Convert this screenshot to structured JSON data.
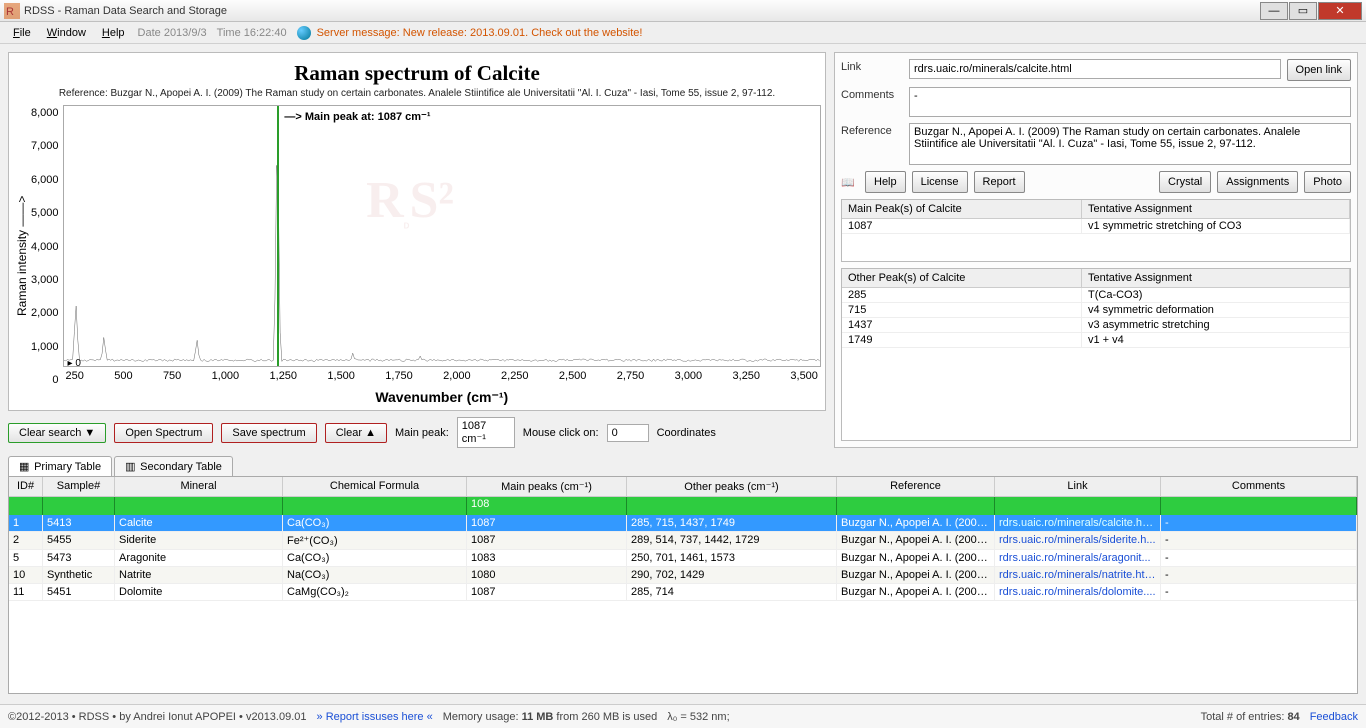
{
  "window": {
    "title": "RDSS - Raman Data Search and Storage"
  },
  "menu": {
    "items": [
      "File",
      "Window",
      "Help"
    ],
    "date_label": "Date 2013/9/3",
    "time_label": "Time 16:22:40",
    "server_msg": "Server message: New release: 2013.09.01. Check out the website!"
  },
  "chart_data": {
    "type": "line",
    "title": "Raman spectrum of Calcite",
    "reference": "Reference: Buzgar N., Apopei A. I. (2009) The Raman study on certain carbonates. Analele Stiintifice ale Universitatii \"Al. I. Cuza\" - Iasi, Tome 55, issue 2, 97-112.",
    "xlabel": "Wavenumber (cm⁻¹)",
    "ylabel": "Raman intensity ——>",
    "xlim": [
      100,
      3600
    ],
    "ylim": [
      0,
      8500
    ],
    "x_ticks": [
      250,
      500,
      750,
      1000,
      1250,
      1500,
      1750,
      2000,
      2250,
      2500,
      2750,
      3000,
      3250,
      3500
    ],
    "y_ticks": [
      0,
      1000,
      2000,
      3000,
      4000,
      5000,
      6000,
      7000,
      8000
    ],
    "main_peak_annotation": "—> Main peak at: 1087 cm⁻¹",
    "peaks": [
      {
        "x": 155,
        "y": 2100
      },
      {
        "x": 285,
        "y": 1000
      },
      {
        "x": 715,
        "y": 900
      },
      {
        "x": 1087,
        "y": 8200
      },
      {
        "x": 1437,
        "y": 450
      },
      {
        "x": 1749,
        "y": 350
      }
    ],
    "baseline": 150
  },
  "toolbar": {
    "clear_search": "Clear search ▼",
    "open_spectrum": "Open Spectrum",
    "save_spectrum": "Save spectrum",
    "clear": "Clear ▲",
    "main_peak_label": "Main peak:",
    "main_peak_value": "1087 cm⁻¹",
    "mouse_click_label": "Mouse click on:",
    "mouse_click_value": "0",
    "coordinates_label": "Coordinates"
  },
  "info": {
    "link_label": "Link",
    "link_value": "rdrs.uaic.ro/minerals/calcite.html",
    "open_link": "Open link",
    "comments_label": "Comments",
    "comments_value": "-",
    "reference_label": "Reference",
    "reference_value": "Buzgar N., Apopei A. I. (2009) The Raman study on certain carbonates. Analele Stiintifice ale Universitatii \"Al. I. Cuza\" - Iasi, Tome 55, issue 2, 97-112.",
    "buttons": {
      "help": "Help",
      "license": "License",
      "report": "Report",
      "crystal": "Crystal",
      "assignments": "Assignments",
      "photo": "Photo"
    },
    "main_peaks": {
      "col1": "Main Peak(s) of Calcite",
      "col2": "Tentative Assignment",
      "rows": [
        {
          "peak": "1087",
          "assign": "v1 symmetric stretching of CO3"
        }
      ]
    },
    "other_peaks": {
      "col1": "Other Peak(s) of Calcite",
      "col2": "Tentative Assignment",
      "rows": [
        {
          "peak": "285",
          "assign": "T(Ca-CO3)"
        },
        {
          "peak": "715",
          "assign": "v4 symmetric deformation"
        },
        {
          "peak": "1437",
          "assign": "v3 asymmetric stretching"
        },
        {
          "peak": "1749",
          "assign": "v1 + v4"
        }
      ]
    }
  },
  "tabs": {
    "primary": "Primary Table",
    "secondary": "Secondary Table"
  },
  "grid": {
    "headers": [
      "ID#",
      "Sample#",
      "Mineral",
      "Chemical Formula",
      "Main peaks (cm⁻¹)",
      "Other peaks (cm⁻¹)",
      "Reference",
      "Link",
      "Comments"
    ],
    "filter_main": "108",
    "rows": [
      {
        "id": "1",
        "sample": "5413",
        "mineral": "Calcite",
        "formula": "Ca(CO₃)",
        "main": "1087",
        "other": "285, 715, 1437, 1749",
        "ref": "Buzgar N., Apopei A. I. (2009...",
        "link": "rdrs.uaic.ro/minerals/calcite.html",
        "com": "-",
        "selected": true
      },
      {
        "id": "2",
        "sample": "5455",
        "mineral": "Siderite",
        "formula": "Fe²⁺(CO₃)",
        "main": "1087",
        "other": "289, 514, 737, 1442, 1729",
        "ref": "Buzgar N., Apopei A. I. (2009...",
        "link": "rdrs.uaic.ro/minerals/siderite.h...",
        "com": "-"
      },
      {
        "id": "5",
        "sample": "5473",
        "mineral": "Aragonite",
        "formula": "Ca(CO₃)",
        "main": "1083",
        "other": "250, 701, 1461, 1573",
        "ref": "Buzgar N., Apopei A. I. (2009...",
        "link": "rdrs.uaic.ro/minerals/aragonit...",
        "com": "-"
      },
      {
        "id": "10",
        "sample": "Synthetic",
        "mineral": "Natrite",
        "formula": "Na(CO₃)",
        "main": "1080",
        "other": "290, 702, 1429",
        "ref": "Buzgar N., Apopei A. I. (2009...",
        "link": "rdrs.uaic.ro/minerals/natrite.html",
        "com": "-"
      },
      {
        "id": "11",
        "sample": "5451",
        "mineral": "Dolomite",
        "formula": "CaMg(CO₃)₂",
        "main": "1087",
        "other": "285, 714",
        "ref": "Buzgar N., Apopei A. I. (2009...",
        "link": "rdrs.uaic.ro/minerals/dolomite....",
        "com": "-"
      }
    ]
  },
  "status": {
    "copyright": "©2012-2013 • RDSS • by Andrei Ionut APOPEI • v2013.09.01",
    "report": "» Report issuses here «",
    "memory": "Memory usage: 11 MB from 260 MB is used",
    "lambda": "λ₀ = 532 nm;",
    "total": "Total # of entries: 84",
    "feedback": "Feedback"
  }
}
